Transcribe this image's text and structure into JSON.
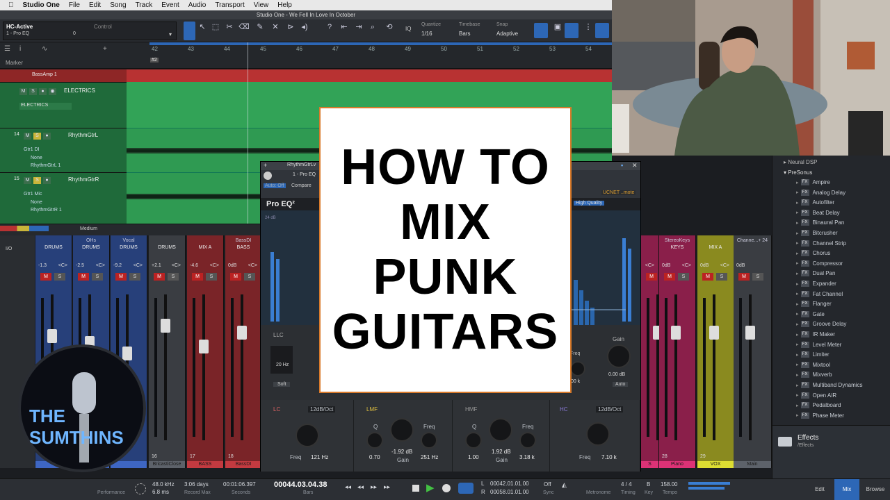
{
  "menubar": {
    "app": "Studio One",
    "items": [
      "File",
      "Edit",
      "Song",
      "Track",
      "Event",
      "Audio",
      "Transport",
      "View",
      "Help"
    ]
  },
  "window_title": "Studio One - We Fell In Love In October",
  "toolbar": {
    "preset_name": "HC-Active",
    "preset_sub": "1 - Pro EQ",
    "control_label": "Control",
    "preset_value": "0",
    "quantize_label": "Quantize",
    "quantize_value": "1/16",
    "timebase_label": "Timebase",
    "timebase_value": "Bars",
    "snap_label": "Snap",
    "snap_value": "Adaptive",
    "iq_label": "IQ"
  },
  "ruler": {
    "numbers": [
      "42",
      "43",
      "44",
      "45",
      "46",
      "47",
      "48",
      "49",
      "50",
      "51",
      "52",
      "53",
      "54"
    ],
    "marker_label": "Marker",
    "marker_tag": "#2"
  },
  "tracks": [
    {
      "name": "BassAmp 1",
      "color": "#b83232"
    },
    {
      "name": "ELECTRICS",
      "sub": "ELECTRICS",
      "color": "#2f8a4c"
    },
    {
      "number": "14",
      "name": "RhythmGtrL",
      "input": "Gtr1 DI",
      "route1": "None",
      "route2": "RhythmGtrL 1",
      "color": "#2f8a4c"
    },
    {
      "number": "15",
      "name": "RhythmGtrR",
      "input": "Gtr1 Mic",
      "route1": "None",
      "route2": "RhythmGtrR 1",
      "color": "#2f8a4c"
    }
  ],
  "mixer": {
    "size_label": "Medium",
    "io_label": "I/O",
    "strips_left": [
      {
        "label": "",
        "bus": "DRUMS",
        "vol": "-1.3",
        "pan": "<C>",
        "color": "#27407a",
        "num": "",
        "name": ""
      },
      {
        "label": "OHs",
        "bus": "DRUMS",
        "vol": "-2.5",
        "pan": "<C>",
        "color": "#27407a",
        "num": "",
        "name": ""
      },
      {
        "label": "Vocal",
        "bus": "DRUMS",
        "vol": "-9.2",
        "pan": "<C>",
        "color": "#27407a",
        "num": "",
        "name": ""
      },
      {
        "label": "",
        "bus": "DRUMS",
        "vol": "+2.1",
        "pan": "<C>",
        "color": "#3a3d42",
        "num": "16",
        "name": "BricastiClose",
        "auto": "Auto: Off"
      },
      {
        "label": "",
        "bus": "MIX A",
        "vol": "-4.6",
        "pan": "<C>",
        "color": "#7a2428",
        "num": "17",
        "name": "BASS",
        "auto": "Auto: Off"
      },
      {
        "label": "BassDI",
        "bus": "BASS",
        "vol": "0dB",
        "pan": "<C>",
        "color": "#7a2428",
        "num": "18",
        "name": "BassDI",
        "auto": "Auto: Off"
      }
    ],
    "strips_right": [
      {
        "label": "",
        "bus": "",
        "vol": "",
        "pan": "<C>",
        "color": "#8a1f4a",
        "num": "",
        "name": "S"
      },
      {
        "label": "StereoKeys",
        "bus": "KEYS",
        "vol": "0dB",
        "pan": "<C>",
        "color": "#8a1f4a",
        "num": "28",
        "name": "Piano",
        "auto": "Auto: Off"
      },
      {
        "label": "",
        "bus": "MIX A",
        "vol": "0dB",
        "pan": "<C>",
        "color": "#8a8a1f",
        "num": "29",
        "name": "VOX",
        "auto": "Auto: Off"
      },
      {
        "label": "Channe...+ 24",
        "bus": "",
        "vol": "0dB",
        "pan": "",
        "color": "#3a3d42",
        "num": "",
        "name": "Main",
        "meter_l": "-19.7",
        "meter_r": "-15.2"
      }
    ]
  },
  "eq": {
    "track": "RhythmGtrLv",
    "preset": "1 - Pro EQ",
    "auto_label": "Auto: Off",
    "compare_label": "Compare",
    "remote_label": "UCNET ..mote",
    "quality_label": "High Quality",
    "logo": "Pro EQ²",
    "llc_label": "LLC",
    "llc_freq": "20 Hz",
    "soft_label": "Soft",
    "gain_label": "Gain",
    "gain_value": "0.00 dB",
    "auto_btn": "Auto",
    "hidden_freq": "Freq",
    "hidden_value": ".00 k",
    "lc": {
      "label": "LC",
      "slope": "12dB/Oct",
      "freq_label": "Freq",
      "freq": "121 Hz"
    },
    "lmf": {
      "label": "LMF",
      "q_label": "Q",
      "q": "0.70",
      "gain": "-1.92 dB",
      "gain_label": "Gain",
      "freq_label": "Freq",
      "freq": "251 Hz"
    },
    "hmf": {
      "label": "HMF",
      "q_label": "Q",
      "q": "1.00",
      "gain": "1.92 dB",
      "gain_label": "Gain",
      "freq_label": "Freq",
      "freq": "3.18 k"
    },
    "hc": {
      "label": "HC",
      "slope": "12dB/Oct",
      "freq_label": "Freq",
      "freq": "7.10 k"
    },
    "scale": [
      "24 dB",
      "18",
      "12",
      "6",
      "0",
      "-6",
      "-12",
      "-18",
      "-24"
    ]
  },
  "title_card": [
    "HOW TO",
    "MIX",
    "PUNK",
    "GUITARS"
  ],
  "browser": {
    "folder": "Neural DSP",
    "vendor": "PreSonus",
    "items": [
      "Ampire",
      "Analog Delay",
      "Autofilter",
      "Beat Delay",
      "Binaural Pan",
      "Bitcrusher",
      "Channel Strip",
      "Chorus",
      "Compressor",
      "Dual Pan",
      "Expander",
      "Fat Channel",
      "Flanger",
      "Gate",
      "Groove Delay",
      "IR Maker",
      "Level Meter",
      "Limiter",
      "Mixtool",
      "Mixverb",
      "Multiband Dynamics",
      "Open AIR",
      "Pedalboard",
      "Phase Meter"
    ],
    "fx_tag": "FX",
    "footer_title": "Effects",
    "footer_path": "/Effects"
  },
  "logo": {
    "text": "THE SUMTHINS"
  },
  "transport": {
    "perf_label": "Performance",
    "sample_rate": "48.0 kHz",
    "latency": "6.8 ms",
    "record_max": "3:06 days",
    "record_max_label": "Record Max",
    "seconds": "00:01:06.397",
    "seconds_label": "Seconds",
    "bars": "00044.03.04.38",
    "bars_label": "Bars",
    "loop_l": "00042.01.01.00",
    "loop_r": "00058.01.01.00",
    "l": "L",
    "r": "R",
    "sync": "Off",
    "sync_label": "Sync",
    "metronome_label": "Metronome",
    "timing": "4 / 4",
    "timing_label": "Timing",
    "key": "B",
    "key_label": "Key",
    "tempo": "158.00",
    "tempo_label": "Tempo",
    "views": [
      "Edit",
      "Mix",
      "Browse"
    ]
  }
}
